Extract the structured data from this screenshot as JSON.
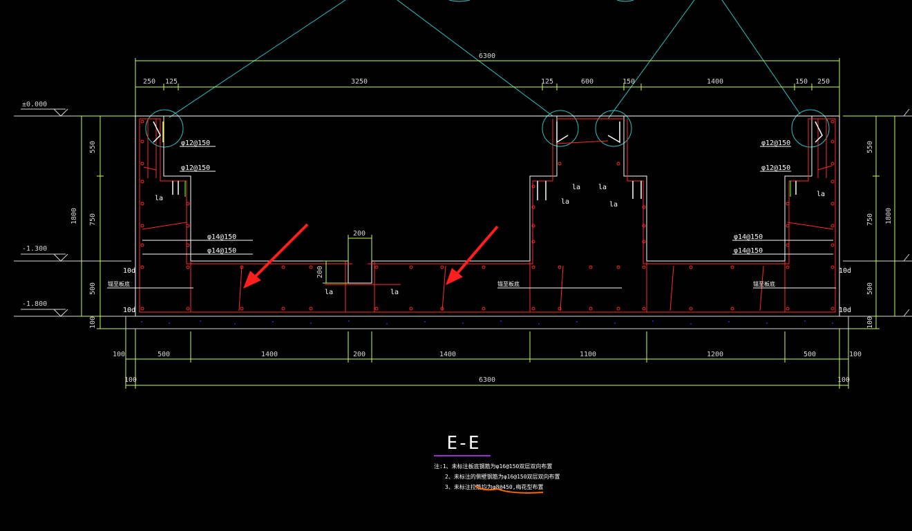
{
  "title": "E-E",
  "colors": {
    "background": "#000000",
    "dimension": "#c8ff5a",
    "rebar": "#ff2a2a",
    "outline": "#ffffff",
    "leader": "#2ec4c4",
    "arrow": "#ff1e1e",
    "underline": "#9a2fd0",
    "scribble": "#ff6a00",
    "bar_symbol": "#ffff00",
    "bar_hook": "#22cc22",
    "foundation_fill": "#1a2bd6"
  },
  "levels": {
    "top": "±0.000",
    "mid": "-1.300",
    "bottom": "-1.800"
  },
  "dims_top": {
    "overall": "6300",
    "segments": [
      "250",
      "125",
      "3250",
      "125",
      "600",
      "150",
      "1400",
      "150",
      "250"
    ]
  },
  "dims_bottom": {
    "segments": [
      "100",
      "500",
      "1400",
      "200",
      "1400",
      "1100",
      "1200",
      "500",
      "100"
    ],
    "overall": "6300",
    "end_left": "100",
    "end_right": "100"
  },
  "dims_left": [
    "550",
    "750",
    "500",
    "100"
  ],
  "dims_left_total": "1800",
  "dims_right": [
    "550",
    "750",
    "500",
    "100"
  ],
  "dims_right_total": "1800",
  "rebar_labels": {
    "top_left_1": "φ12@150",
    "top_left_2": "φ12@150",
    "top_right_1": "φ12@150",
    "top_right_2": "φ12@150",
    "mid_left_1": "φ14@150",
    "mid_left_2": "φ14@150",
    "mid_right_1": "φ14@150",
    "mid_right_2": "φ14@150",
    "la": "la",
    "ten_d": "10d",
    "to_base": "锚至板底"
  },
  "groove": {
    "width": "200",
    "depth": "200"
  },
  "notes": [
    "注:1、未标注板底钢筋为φ16@150双层双向布置",
    "2、未标注的侧壁钢筋为φ16@150双层双向布置",
    "3、未标注拉筋均为φ8@450,梅花型布置"
  ]
}
